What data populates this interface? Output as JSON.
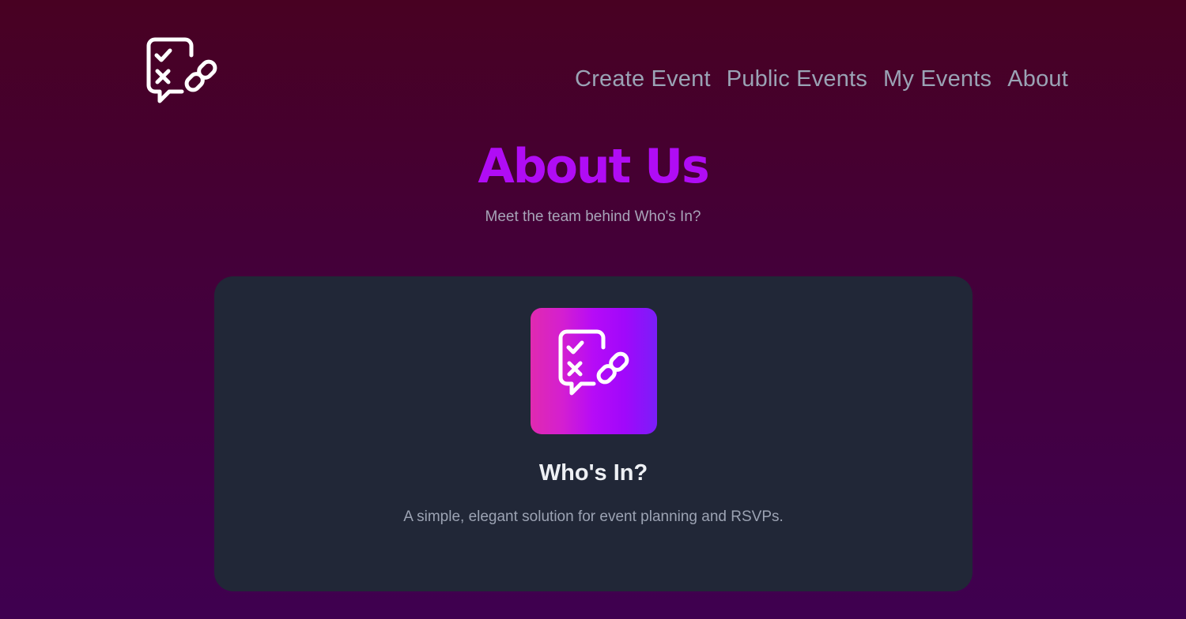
{
  "nav": {
    "items": [
      {
        "label": "Create Event"
      },
      {
        "label": "Public Events"
      },
      {
        "label": "My Events"
      },
      {
        "label": "About"
      }
    ]
  },
  "logo": {
    "icon": "chat-check-link-icon"
  },
  "page": {
    "title": "About Us",
    "subtitle": "Meet the team behind Who's In?"
  },
  "card": {
    "icon": "chat-check-link-icon",
    "title": "Who's In?",
    "description": "A simple, elegant solution for event planning and RSVPs."
  },
  "colors": {
    "title": "#b00cf5",
    "card_bg": "#212737",
    "nav_text": "#9aa3b5",
    "bg_top": "#480122",
    "bg_bottom": "#3f0050"
  }
}
